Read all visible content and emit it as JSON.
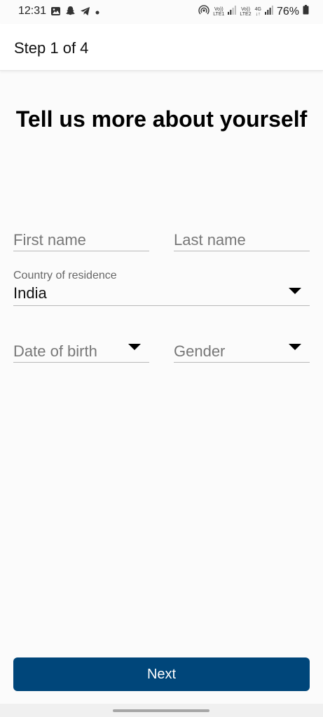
{
  "status_bar": {
    "time": "12:31",
    "battery": "76%",
    "net1_top": "Vo))",
    "net1_bottom": "LTE1",
    "net2_top": "Vo))",
    "net2_bottom": "LTE2",
    "gen": "4G",
    "left_icons": [
      "gallery-icon",
      "snapchat-icon",
      "telegram-icon",
      "dot-icon"
    ],
    "right_icons": [
      "hotspot-icon",
      "signal-icon",
      "signal-icon",
      "battery-icon"
    ]
  },
  "header": {
    "title": "Step 1 of 4"
  },
  "page": {
    "title": "Tell us more about yourself"
  },
  "form": {
    "first_name_placeholder": "First name",
    "last_name_placeholder": "Last name",
    "country_label": "Country of residence",
    "country_value": "India",
    "dob_placeholder": "Date of birth",
    "gender_placeholder": "Gender"
  },
  "actions": {
    "next_label": "Next"
  },
  "colors": {
    "primary": "#00467a",
    "background": "#fbfbfb"
  }
}
